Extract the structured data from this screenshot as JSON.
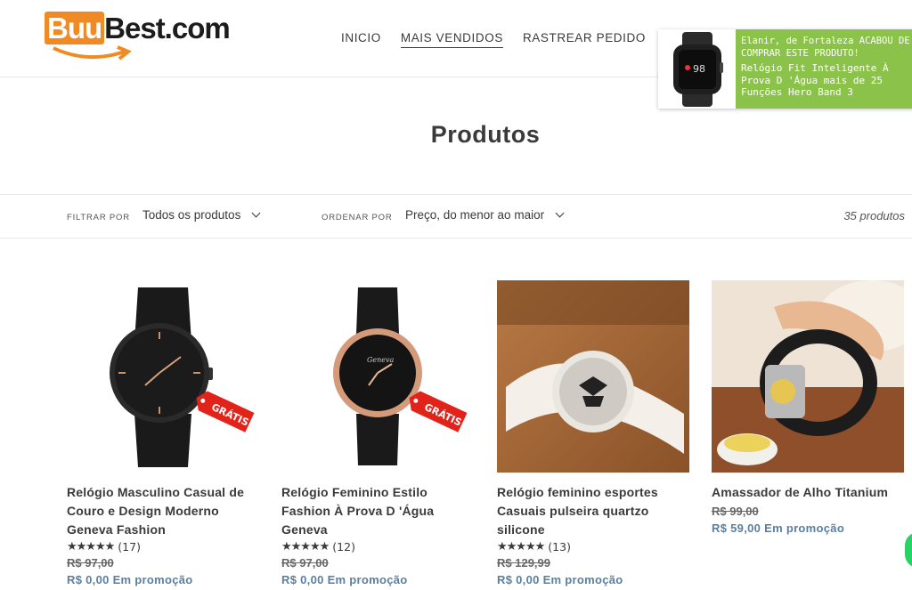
{
  "logo": {
    "part1": "Buu",
    "part2": "Best.com"
  },
  "nav": [
    {
      "label": "INICIO"
    },
    {
      "label": "MAIS VENDIDOS"
    },
    {
      "label": "RASTREAR PEDIDO"
    }
  ],
  "toast": {
    "line1": "Elanir, de Fortaleza ACABOU DE COMPRAR ESTE PRODUTO!",
    "line2": "Relógio Fit Inteligente À Prova D 'Água mais de 25 Funções Hero Band 3",
    "watch_value": "98"
  },
  "page_title": "Produtos",
  "filters": {
    "filter_label": "FILTRAR POR",
    "filter_value": "Todos os produtos",
    "sort_label": "ORDENAR POR",
    "sort_value": "Preço, do menor ao maior",
    "count": "35 produtos"
  },
  "badge_text": "GRÁTIS",
  "products": [
    {
      "name": "Relógio Masculino Casual de Couro e Design Moderno Geneva Fashion",
      "stars": "★★★★★",
      "reviews": "(17)",
      "old_price": "R$ 97,00",
      "new_price": "R$ 0,00",
      "promo": "Em promoção"
    },
    {
      "name": "Relógio Feminino Estilo Fashion À Prova D 'Água Geneva",
      "stars": "★★★★★",
      "reviews": "(12)",
      "old_price": "R$ 97,00",
      "new_price": "R$ 0,00",
      "promo": "Em promoção"
    },
    {
      "name": "Relógio feminino esportes Casuais pulseira quartzo silicone",
      "stars": "★★★★★",
      "reviews": "(13)",
      "old_price": "R$ 129,99",
      "new_price": "R$ 0,00",
      "promo": "Em promoção"
    },
    {
      "name": "Amassador de Alho Titanium",
      "old_price": "R$ 99,00",
      "new_price": "R$ 59,00",
      "promo": "Em promoção"
    }
  ]
}
